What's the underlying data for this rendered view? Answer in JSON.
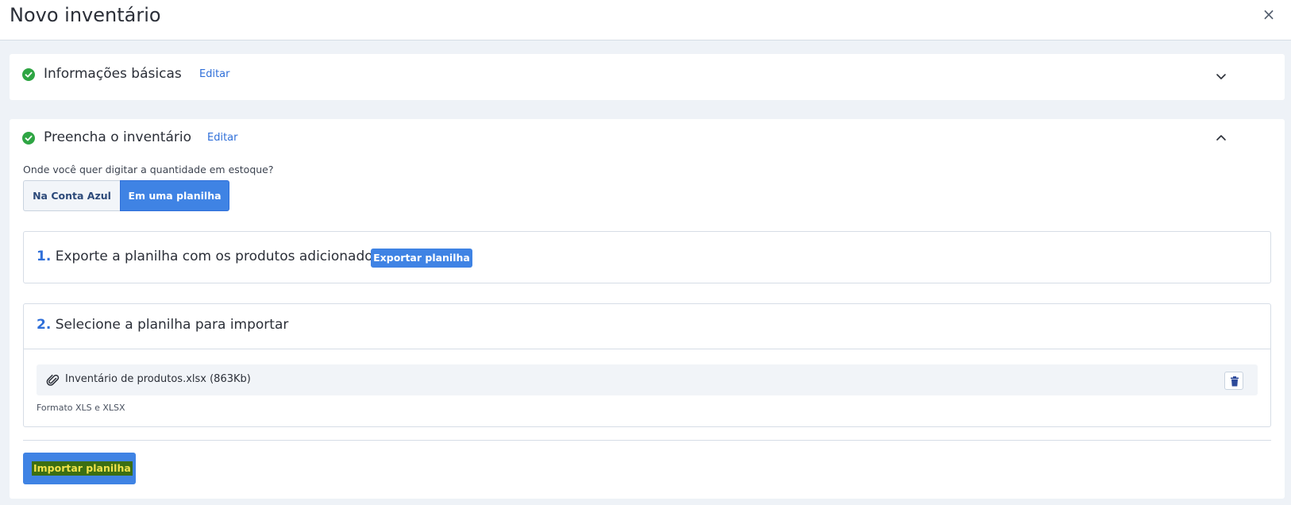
{
  "header": {
    "title": "Novo inventário",
    "close_label": "×"
  },
  "sections": {
    "basic": {
      "title": "Informações básicas",
      "edit_label": "Editar",
      "icon": "check-circle-icon",
      "expanded": false
    },
    "fill": {
      "title": "Preencha o inventário",
      "edit_label": "Editar",
      "icon": "check-circle-icon",
      "expanded": true,
      "question": "Onde você quer digitar a quantidade em estoque?",
      "toggle": {
        "options": [
          "Na Conta Azul",
          "Em uma planilha"
        ],
        "selected": "Em uma planilha"
      },
      "step1": {
        "number": "1.",
        "text": "Exporte a planilha com os produtos adicionados",
        "button_label": "Exportar planilha"
      },
      "step2": {
        "number": "2.",
        "text": "Selecione a planilha para importar",
        "file": {
          "name": "Inventário de produtos.xlsx (863Kb)",
          "icon": "paperclip-icon",
          "remove_icon": "trash-icon"
        },
        "format_note": "Formato XLS e XLSX"
      },
      "import_button_label": "Importar planilha"
    }
  },
  "colors": {
    "accent": "#3f83e4",
    "link": "#2f6fd9",
    "success": "#2ea543",
    "background": "#eef2f7"
  }
}
